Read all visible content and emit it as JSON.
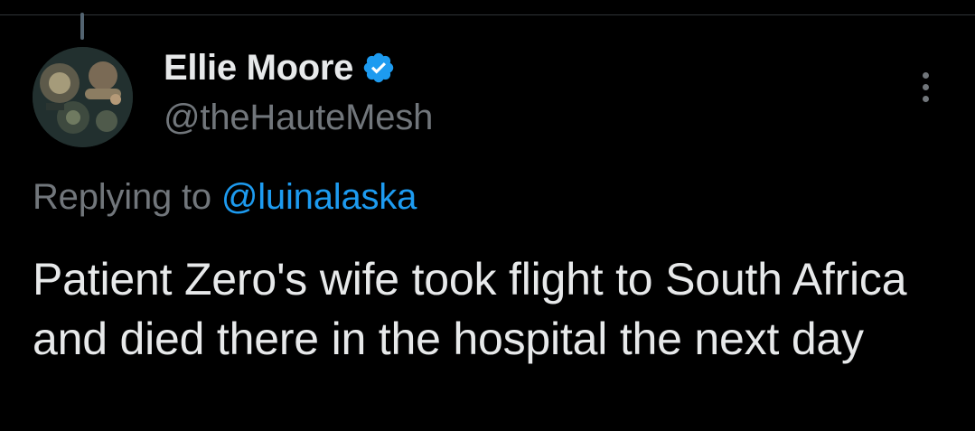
{
  "author": {
    "name": "Ellie Moore",
    "handle": "@theHauteMesh",
    "verified": true,
    "avatar_icon": "steampunk-jewelry-avatar"
  },
  "reply": {
    "prefix": "Replying to ",
    "handle": "@luinalaska"
  },
  "tweet": {
    "text": "Patient Zero's wife took flight to South Africa  and died there in the hospital the next day"
  },
  "icons": {
    "verified": "verified-badge-icon",
    "more": "more-options-icon"
  },
  "colors": {
    "background": "#000000",
    "primary_text": "#e7e9ea",
    "secondary_text": "#71767b",
    "link": "#1d9bf0",
    "verified_badge": "#1d9bf0"
  }
}
